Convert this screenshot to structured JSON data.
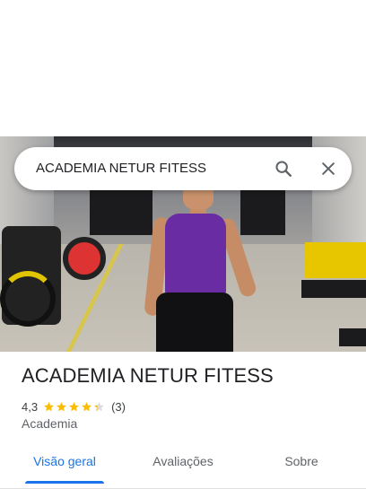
{
  "search": {
    "query": "ACADEMIA NETUR FITESS"
  },
  "place": {
    "name": "ACADEMIA NETUR FITESS",
    "rating": "4,3",
    "rating_value": 4.3,
    "star_count": 5,
    "review_count": "(3)",
    "category": "Academia"
  },
  "tabs": [
    {
      "label": "Visão geral",
      "active": true
    },
    {
      "label": "Avaliações",
      "active": false
    },
    {
      "label": "Sobre",
      "active": false
    }
  ],
  "colors": {
    "accent": "#1a73e8",
    "star": "#fbbc04",
    "text_primary": "#202124",
    "text_secondary": "#5f6368"
  },
  "icons": [
    "search-icon",
    "close-icon",
    "star-icon"
  ]
}
